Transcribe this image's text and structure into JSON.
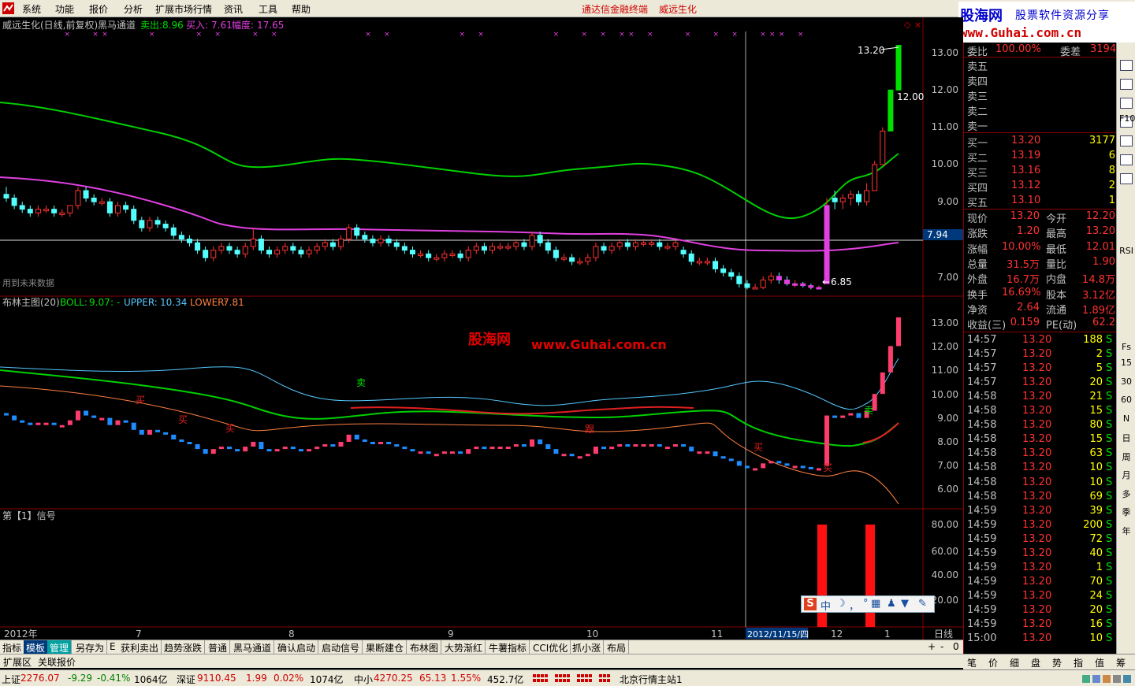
{
  "menubar": {
    "items": [
      "系统",
      "功能",
      "报价",
      "分析",
      "扩展市场行情",
      "资讯",
      "工具",
      "帮助"
    ],
    "center_title": "通达信金融终端",
    "stock_title": "威远生化"
  },
  "brand": {
    "name": "股海网",
    "slogan": "股票软件资源分享",
    "url": "www.Guhai.com.cn"
  },
  "watermark": {
    "name": "股海网",
    "url": "www.Guhai.com.cn"
  },
  "colors": {
    "up": "#ff3232",
    "down": "#54ffff",
    "green": "#00e000",
    "magenta": "#e040e0",
    "yellow": "#ffff00",
    "label": "#c0c0c0"
  },
  "main_pane": {
    "title": "威远生化(日线,前复权)",
    "indicator": "黑马通道",
    "sell_label": "卖出:",
    "sell_value": "8.96",
    "buy_label": "买入:",
    "buy_value": "7.61",
    "range_label": "幅度:",
    "range_value": "17.65",
    "note": "用到未来数据",
    "high_label": "13.20",
    "low_label": "6.85",
    "mark_1200": "12.00",
    "cur_price": "7.94",
    "yticks": [
      "13.00",
      "12.00",
      "11.00",
      "10.00",
      "9.00",
      "7.00"
    ]
  },
  "boll_pane": {
    "title": "布林主图(20)",
    "boll_label": "BOLL:",
    "boll_value": "9.07",
    "upper_label": "UPPER:",
    "upper_value": "10.34",
    "lower_label": "LOWER:",
    "lower_value": "7.81",
    "yticks": [
      "13.00",
      "12.00",
      "11.00",
      "10.00",
      "9.00",
      "8.00",
      "7.00",
      "6.00"
    ],
    "signals": [
      "卖",
      "买",
      "买",
      "买",
      "跟",
      "买",
      "买",
      "卖"
    ]
  },
  "signal_pane": {
    "title": "第【1】信号",
    "yticks": [
      "80.00",
      "60.00",
      "40.00",
      "20.00"
    ]
  },
  "xaxis": {
    "labels": [
      "2012年",
      "7",
      "8",
      "9",
      "10",
      "11",
      "12",
      "1"
    ],
    "cursor_date": "2012/11/15/四",
    "period": "日线"
  },
  "bottom_tabs": [
    "指标",
    "模板",
    "管理",
    "另存为",
    "E",
    "获利卖出",
    "趋势涨跌",
    "普通",
    "黑马通道",
    "确认启动",
    "启动信号",
    "果断建仓",
    "布林图",
    "大势渐红",
    "牛薯指标",
    "CCI优化",
    "抓小涨",
    "布局"
  ],
  "bottom_controls": [
    "+",
    "-",
    "0"
  ],
  "ext_bar": [
    "扩展区",
    "关联报价"
  ],
  "quote": {
    "ratio_label": "委比",
    "ratio_value": "100.00%",
    "diff_label": "委差",
    "diff_value": "3194",
    "sells": [
      {
        "label": "卖五"
      },
      {
        "label": "卖四"
      },
      {
        "label": "卖三"
      },
      {
        "label": "卖二"
      },
      {
        "label": "卖一"
      }
    ],
    "buys": [
      {
        "label": "买一",
        "price": "13.20",
        "vol": "3177"
      },
      {
        "label": "买二",
        "price": "13.19",
        "vol": "6"
      },
      {
        "label": "买三",
        "price": "13.16",
        "vol": "8"
      },
      {
        "label": "买四",
        "price": "13.12",
        "vol": "2"
      },
      {
        "label": "买五",
        "price": "13.10",
        "vol": "1"
      }
    ],
    "stats": [
      {
        "l1": "现价",
        "v1": "13.20",
        "l2": "今开",
        "v2": "12.20"
      },
      {
        "l1": "涨跌",
        "v1": "1.20",
        "l2": "最高",
        "v2": "13.20"
      },
      {
        "l1": "涨幅",
        "v1": "10.00%",
        "l2": "最低",
        "v2": "12.01"
      },
      {
        "l1": "总量",
        "v1": "31.5万",
        "l2": "量比",
        "v2": "1.90"
      },
      {
        "l1": "外盘",
        "v1": "16.7万",
        "l2": "内盘",
        "v2": "14.8万"
      },
      {
        "l1": "换手",
        "v1": "16.69%",
        "l2": "股本",
        "v2": "3.12亿"
      },
      {
        "l1": "净资",
        "v1": "2.64",
        "l2": "流通",
        "v2": "1.89亿"
      },
      {
        "l1": "收益(三)",
        "v1": "0.159",
        "l2": "PE(动)",
        "v2": "62.2"
      }
    ],
    "ticks": [
      {
        "t": "14:57",
        "p": "13.20",
        "v": "188",
        "s": "S"
      },
      {
        "t": "14:57",
        "p": "13.20",
        "v": "2",
        "s": "S"
      },
      {
        "t": "14:57",
        "p": "13.20",
        "v": "5",
        "s": "S"
      },
      {
        "t": "14:57",
        "p": "13.20",
        "v": "20",
        "s": "S"
      },
      {
        "t": "14:58",
        "p": "13.20",
        "v": "21",
        "s": "S"
      },
      {
        "t": "14:58",
        "p": "13.20",
        "v": "15",
        "s": "S"
      },
      {
        "t": "14:58",
        "p": "13.20",
        "v": "80",
        "s": "S"
      },
      {
        "t": "14:58",
        "p": "13.20",
        "v": "15",
        "s": "S"
      },
      {
        "t": "14:58",
        "p": "13.20",
        "v": "63",
        "s": "S"
      },
      {
        "t": "14:58",
        "p": "13.20",
        "v": "10",
        "s": "S"
      },
      {
        "t": "14:58",
        "p": "13.20",
        "v": "10",
        "s": "S"
      },
      {
        "t": "14:58",
        "p": "13.20",
        "v": "69",
        "s": "S"
      },
      {
        "t": "14:59",
        "p": "13.20",
        "v": "39",
        "s": "S"
      },
      {
        "t": "14:59",
        "p": "13.20",
        "v": "200",
        "s": "S"
      },
      {
        "t": "14:59",
        "p": "13.20",
        "v": "72",
        "s": "S"
      },
      {
        "t": "14:59",
        "p": "13.20",
        "v": "40",
        "s": "S"
      },
      {
        "t": "14:59",
        "p": "13.20",
        "v": "1",
        "s": "S"
      },
      {
        "t": "14:59",
        "p": "13.20",
        "v": "70",
        "s": "S"
      },
      {
        "t": "14:59",
        "p": "13.20",
        "v": "24",
        "s": "S"
      },
      {
        "t": "14:59",
        "p": "13.20",
        "v": "20",
        "s": "S"
      },
      {
        "t": "14:59",
        "p": "13.20",
        "v": "16",
        "s": "S"
      },
      {
        "t": "15:00",
        "p": "13.20",
        "v": "10",
        "s": "S"
      }
    ]
  },
  "right_tabs": [
    "笔",
    "价",
    "细",
    "盘",
    "势",
    "指",
    "值",
    "筹"
  ],
  "sidebar": [
    "F10",
    "RSI",
    "Fs",
    "15",
    "30",
    "60",
    "N",
    "日",
    "周",
    "月",
    "多",
    "季",
    "年"
  ],
  "status": {
    "sh_label": "上证",
    "sh_val": "2276.07",
    "sh_chg": "-9.29",
    "sh_pct": "-0.41%",
    "sh_amt": "1064亿",
    "sz_label": "深证",
    "sz_val": "9110.45",
    "sz_chg": "1.99",
    "sz_pct": "0.02%",
    "sz_amt": "1074亿",
    "zx_label": "中小",
    "zx_val": "4270.25",
    "zx_chg": "65.13",
    "zx_pct": "1.55%",
    "zx_amt": "452.7亿",
    "server": "北京行情主站1"
  },
  "ime": {
    "items": [
      "中",
      "·",
      "，",
      "⌨",
      "♟",
      "👕",
      "🔧"
    ]
  },
  "chart_data": {
    "type": "candlestick",
    "candles": [
      [
        9.2,
        9.4,
        9.0,
        9.1
      ],
      [
        9.1,
        9.2,
        8.8,
        8.9
      ],
      [
        8.9,
        9.0,
        8.7,
        8.8
      ],
      [
        8.8,
        8.9,
        8.6,
        8.7
      ],
      [
        8.7,
        8.9,
        8.6,
        8.8
      ],
      [
        8.8,
        8.9,
        8.7,
        8.8
      ],
      [
        8.8,
        8.9,
        8.6,
        8.7
      ],
      [
        8.7,
        8.8,
        8.6,
        8.7
      ],
      [
        8.7,
        8.9,
        8.6,
        8.9
      ],
      [
        8.9,
        9.4,
        8.8,
        9.3
      ],
      [
        9.3,
        9.4,
        9.0,
        9.1
      ],
      [
        9.1,
        9.2,
        8.9,
        9.0
      ],
      [
        9.0,
        9.1,
        8.9,
        9.0
      ],
      [
        9.0,
        9.1,
        8.6,
        8.7
      ],
      [
        8.7,
        9.0,
        8.6,
        8.9
      ],
      [
        8.9,
        9.0,
        8.7,
        8.8
      ],
      [
        8.8,
        8.9,
        8.4,
        8.5
      ],
      [
        8.5,
        8.6,
        8.2,
        8.3
      ],
      [
        8.3,
        8.6,
        8.2,
        8.5
      ],
      [
        8.5,
        8.6,
        8.3,
        8.4
      ],
      [
        8.4,
        8.5,
        8.2,
        8.3
      ],
      [
        8.3,
        8.4,
        8.0,
        8.1
      ],
      [
        8.1,
        8.2,
        7.9,
        8.0
      ],
      [
        8.0,
        8.1,
        7.8,
        7.9
      ],
      [
        7.9,
        8.0,
        7.6,
        7.7
      ],
      [
        7.7,
        7.8,
        7.4,
        7.5
      ],
      [
        7.5,
        7.8,
        7.4,
        7.7
      ],
      [
        7.7,
        7.9,
        7.6,
        7.8
      ],
      [
        7.8,
        7.9,
        7.6,
        7.7
      ],
      [
        7.7,
        7.8,
        7.5,
        7.6
      ],
      [
        7.6,
        7.9,
        7.5,
        7.8
      ],
      [
        7.8,
        8.3,
        7.7,
        8.0
      ],
      [
        8.0,
        8.1,
        7.6,
        7.7
      ],
      [
        7.7,
        7.8,
        7.5,
        7.6
      ],
      [
        7.6,
        7.8,
        7.5,
        7.7
      ],
      [
        7.7,
        7.9,
        7.6,
        7.8
      ],
      [
        7.8,
        7.9,
        7.6,
        7.7
      ],
      [
        7.7,
        7.8,
        7.5,
        7.6
      ],
      [
        7.6,
        7.8,
        7.5,
        7.7
      ],
      [
        7.7,
        7.9,
        7.6,
        7.8
      ],
      [
        7.8,
        8.0,
        7.7,
        7.9
      ],
      [
        7.9,
        8.0,
        7.7,
        7.8
      ],
      [
        7.8,
        8.1,
        7.7,
        8.0
      ],
      [
        8.0,
        8.4,
        7.9,
        8.3
      ],
      [
        8.3,
        8.4,
        8.0,
        8.1
      ],
      [
        8.1,
        8.2,
        7.9,
        8.0
      ],
      [
        8.0,
        8.1,
        7.8,
        7.9
      ],
      [
        7.9,
        8.1,
        7.8,
        8.0
      ],
      [
        8.0,
        8.1,
        7.8,
        7.9
      ],
      [
        7.9,
        8.0,
        7.7,
        7.8
      ],
      [
        7.8,
        7.9,
        7.6,
        7.7
      ],
      [
        7.7,
        7.8,
        7.5,
        7.6
      ],
      [
        7.6,
        7.7,
        7.5,
        7.6
      ],
      [
        7.6,
        7.7,
        7.4,
        7.5
      ],
      [
        7.5,
        7.6,
        7.4,
        7.5
      ],
      [
        7.5,
        7.7,
        7.4,
        7.6
      ],
      [
        7.6,
        7.7,
        7.5,
        7.6
      ],
      [
        7.6,
        7.7,
        7.4,
        7.5
      ],
      [
        7.5,
        7.8,
        7.4,
        7.7
      ],
      [
        7.7,
        7.9,
        7.6,
        7.8
      ],
      [
        7.8,
        7.9,
        7.6,
        7.7
      ],
      [
        7.7,
        7.9,
        7.6,
        7.8
      ],
      [
        7.8,
        7.9,
        7.7,
        7.8
      ],
      [
        7.8,
        7.9,
        7.7,
        7.8
      ],
      [
        7.8,
        8.0,
        7.7,
        7.9
      ],
      [
        7.9,
        8.0,
        7.7,
        7.8
      ],
      [
        7.8,
        8.2,
        7.7,
        8.1
      ],
      [
        8.1,
        8.2,
        7.8,
        7.9
      ],
      [
        7.9,
        8.0,
        7.6,
        7.7
      ],
      [
        7.7,
        7.8,
        7.4,
        7.5
      ],
      [
        7.5,
        7.6,
        7.4,
        7.5
      ],
      [
        7.5,
        7.6,
        7.3,
        7.4
      ],
      [
        7.4,
        7.5,
        7.3,
        7.4
      ],
      [
        7.4,
        7.6,
        7.3,
        7.5
      ],
      [
        7.5,
        7.9,
        7.4,
        7.8
      ],
      [
        7.8,
        7.9,
        7.6,
        7.7
      ],
      [
        7.7,
        7.9,
        7.6,
        7.8
      ],
      [
        7.8,
        8.0,
        7.7,
        7.9
      ],
      [
        7.9,
        8.0,
        7.7,
        7.8
      ],
      [
        7.8,
        8.0,
        7.7,
        7.9
      ],
      [
        7.9,
        8.0,
        7.8,
        7.9
      ],
      [
        7.9,
        8.0,
        7.8,
        7.9
      ],
      [
        7.9,
        8.0,
        7.7,
        7.8
      ],
      [
        7.8,
        7.9,
        7.7,
        7.8
      ],
      [
        7.8,
        8.0,
        7.7,
        7.9
      ],
      [
        7.9,
        8.0,
        7.7,
        7.8
      ],
      [
        7.8,
        7.9,
        7.5,
        7.6
      ],
      [
        7.6,
        7.7,
        7.5,
        7.6
      ],
      [
        7.6,
        7.7,
        7.5,
        7.6
      ],
      [
        7.6,
        7.7,
        7.3,
        7.4
      ],
      [
        7.4,
        7.5,
        7.2,
        7.3
      ],
      [
        7.3,
        7.4,
        7.1,
        7.2
      ],
      [
        7.2,
        7.3,
        6.9,
        7.0
      ],
      [
        7.0,
        7.1,
        6.85,
        6.9
      ],
      [
        6.9,
        7.0,
        6.85,
        6.9
      ],
      [
        6.9,
        7.2,
        6.85,
        7.1
      ],
      [
        7.1,
        7.3,
        7.0,
        7.2
      ],
      [
        7.2,
        7.3,
        7.0,
        7.1
      ],
      [
        7.1,
        7.2,
        6.95,
        7.0
      ],
      [
        7.0,
        7.1,
        6.9,
        7.0
      ],
      [
        7.0,
        7.05,
        6.9,
        6.95
      ],
      [
        6.95,
        7.0,
        6.85,
        6.9
      ],
      [
        6.9,
        6.95,
        6.85,
        6.9
      ],
      [
        7.0,
        9.3,
        8.6,
        9.1
      ],
      [
        9.1,
        9.3,
        8.8,
        9.0
      ],
      [
        9.0,
        9.2,
        8.8,
        9.1
      ],
      [
        9.1,
        9.3,
        8.9,
        9.2
      ],
      [
        9.2,
        9.3,
        8.9,
        9.0
      ],
      [
        9.0,
        9.5,
        8.9,
        9.3
      ],
      [
        9.3,
        10.1,
        9.3,
        10.0
      ],
      [
        10.0,
        11.0,
        10.0,
        10.9
      ],
      [
        10.9,
        12.0,
        10.9,
        12.0
      ],
      [
        12.0,
        13.2,
        12.0,
        13.2
      ]
    ]
  }
}
